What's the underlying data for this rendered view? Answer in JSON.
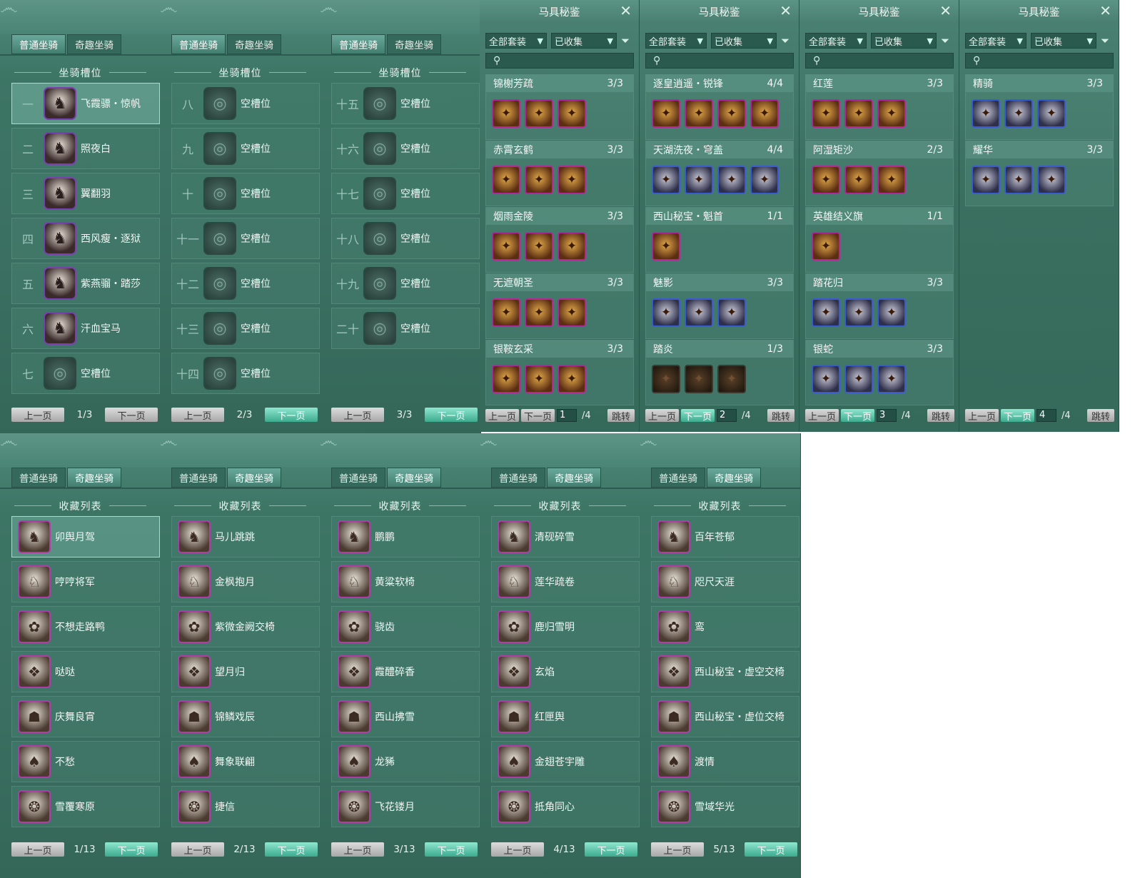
{
  "tabs": {
    "normal": "普通坐骑",
    "fun": "奇趣坐骑"
  },
  "slot_section": "坐骑槽位",
  "collection_section": "收藏列表",
  "pager": {
    "prev": "上一页",
    "next": "下一页",
    "jump": "跳转"
  },
  "book": {
    "title": "马具秘鉴",
    "filter_all": "全部套装",
    "filter_collected": "已收集"
  },
  "slot_pages": [
    {
      "page": "1/3",
      "slots": [
        {
          "num": "一",
          "name": "飞霞骠・惊帆",
          "sel": true
        },
        {
          "num": "二",
          "name": "照夜白"
        },
        {
          "num": "三",
          "name": "翼翻羽"
        },
        {
          "num": "四",
          "name": "西风瘦・逐狱"
        },
        {
          "num": "五",
          "name": "紫燕骝・踏莎"
        },
        {
          "num": "六",
          "name": "汗血宝马"
        },
        {
          "num": "七",
          "name": "空槽位",
          "empty": true
        }
      ]
    },
    {
      "page": "2/3",
      "slots": [
        {
          "num": "八",
          "name": "空槽位",
          "empty": true
        },
        {
          "num": "九",
          "name": "空槽位",
          "empty": true
        },
        {
          "num": "十",
          "name": "空槽位",
          "empty": true
        },
        {
          "num": "十一",
          "name": "空槽位",
          "empty": true
        },
        {
          "num": "十二",
          "name": "空槽位",
          "empty": true
        },
        {
          "num": "十三",
          "name": "空槽位",
          "empty": true
        },
        {
          "num": "十四",
          "name": "空槽位",
          "empty": true
        }
      ]
    },
    {
      "page": "3/3",
      "slots": [
        {
          "num": "十五",
          "name": "空槽位",
          "empty": true
        },
        {
          "num": "十六",
          "name": "空槽位",
          "empty": true
        },
        {
          "num": "十七",
          "name": "空槽位",
          "empty": true
        },
        {
          "num": "十八",
          "name": "空槽位",
          "empty": true
        },
        {
          "num": "十九",
          "name": "空槽位",
          "empty": true
        },
        {
          "num": "二十",
          "name": "空槽位",
          "empty": true
        }
      ]
    }
  ],
  "book_pages": [
    {
      "page": "1",
      "total": "/4",
      "sets": [
        {
          "name": "锦榭芳疏",
          "count": "3/3",
          "items": 3
        },
        {
          "name": "赤霄玄鹤",
          "count": "3/3",
          "items": 3
        },
        {
          "name": "烟雨金陵",
          "count": "3/3",
          "items": 3
        },
        {
          "name": "无遮朝圣",
          "count": "3/3",
          "items": 3
        },
        {
          "name": "银鞍玄采",
          "count": "3/3",
          "items": 3
        }
      ]
    },
    {
      "page": "2",
      "total": "/4",
      "sets": [
        {
          "name": "逐皇逍遥・锐锋",
          "count": "4/4",
          "items": 4
        },
        {
          "name": "天湖洗夜・穹盖",
          "count": "4/4",
          "items": 4,
          "blue": true
        },
        {
          "name": "西山秘宝・魁首",
          "count": "1/1",
          "items": 1
        },
        {
          "name": "魅影",
          "count": "3/3",
          "items": 3,
          "blue": true
        },
        {
          "name": "踏炎",
          "count": "1/3",
          "items": 3,
          "dim": true
        }
      ]
    },
    {
      "page": "3",
      "total": "/4",
      "sets": [
        {
          "name": "红莲",
          "count": "3/3",
          "items": 3
        },
        {
          "name": "阿湿矩沙",
          "count": "2/3",
          "items": 3
        },
        {
          "name": "英雄结义旗",
          "count": "1/1",
          "items": 1
        },
        {
          "name": "踏花归",
          "count": "3/3",
          "items": 3,
          "blue": true
        },
        {
          "name": "银蛇",
          "count": "3/3",
          "items": 3,
          "blue": true
        }
      ]
    },
    {
      "page": "4",
      "total": "/4",
      "sets": [
        {
          "name": "精骑",
          "count": "3/3",
          "items": 3,
          "blue": true
        },
        {
          "name": "耀华",
          "count": "3/3",
          "items": 3,
          "blue": true
        }
      ]
    }
  ],
  "collection_pages": [
    {
      "page": "1/13",
      "items": [
        "卯舆月驾",
        "哼哼将军",
        "不想走路鸭",
        "哒哒",
        "庆舞良宵",
        "不愁",
        "雪覆寒原"
      ]
    },
    {
      "page": "2/13",
      "items": [
        "马儿跳跳",
        "金枫抱月",
        "紫微金阙交椅",
        "望月归",
        "锦鳞戏辰",
        "舞象联翩",
        "捷信"
      ]
    },
    {
      "page": "3/13",
      "items": [
        "鹏鹏",
        "黄粱软椅",
        "骁齿",
        "霞醴碎香",
        "西山拂雪",
        "龙豨",
        "飞花镂月"
      ]
    },
    {
      "page": "4/13",
      "items": [
        "清砚碎雪",
        "莲华疏卷",
        "鹿归雪明",
        "玄焰",
        "红匣舆",
        "金翅苍宇雕",
        "抵角同心"
      ]
    },
    {
      "page": "5/13",
      "items": [
        "百年苍郁",
        "咫尺天涯",
        "鸾",
        "西山秘宝・虚空交椅",
        "西山秘宝・虚位交椅",
        "渡情",
        "雪域华光"
      ]
    }
  ]
}
